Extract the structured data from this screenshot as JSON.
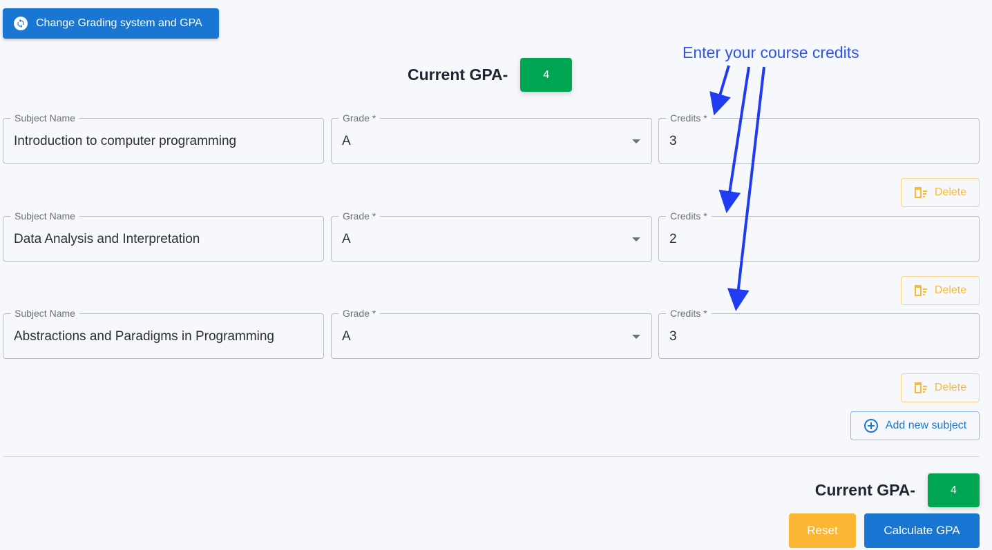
{
  "toolbar": {
    "change_grading_label": "Change Grading system and GPA"
  },
  "gpa": {
    "label": "Current GPA-",
    "value": "4"
  },
  "annotation": {
    "text": "Enter your course credits"
  },
  "fields": {
    "subject_label": "Subject Name",
    "grade_label": "Grade *",
    "credits_label": "Credits *"
  },
  "subjects": [
    {
      "name": "Introduction to computer programming",
      "grade": "A",
      "credits": "3"
    },
    {
      "name": "Data Analysis and Interpretation",
      "grade": "A",
      "credits": "2"
    },
    {
      "name": "Abstractions and Paradigms in Programming",
      "grade": "A",
      "credits": "3"
    }
  ],
  "buttons": {
    "delete": "Delete",
    "add_subject": "Add new subject",
    "reset": "Reset",
    "calculate": "Calculate GPA"
  },
  "colors": {
    "primary": "#1976d2",
    "success": "#00a651",
    "warning": "#fbb733",
    "annotation": "#2f54eb"
  }
}
